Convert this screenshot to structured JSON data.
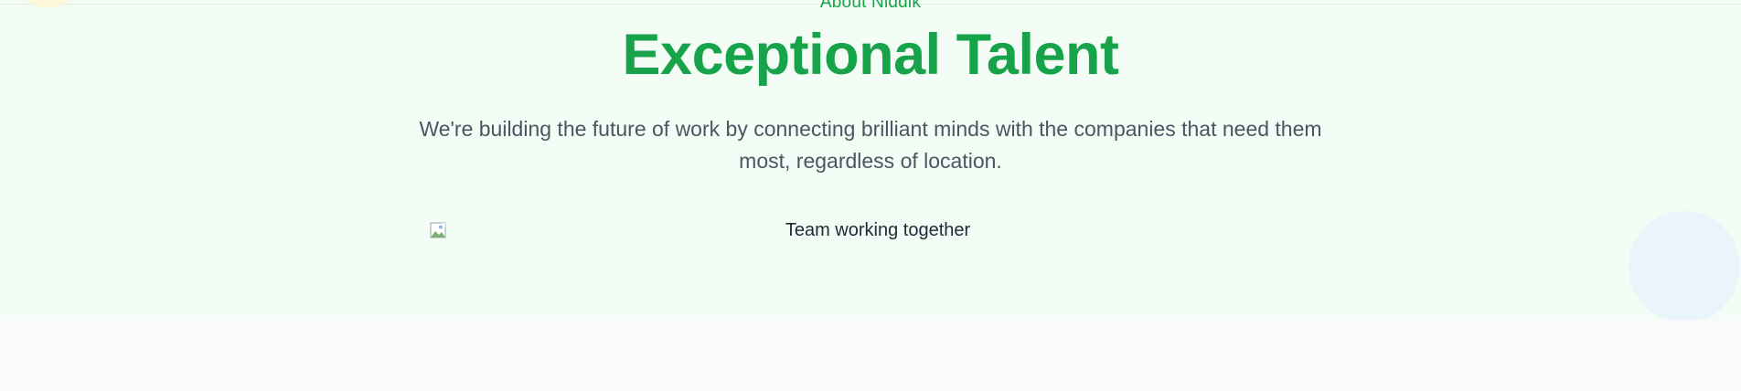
{
  "about": {
    "eyebrow": "About Niddik",
    "headline": "Exceptional Talent",
    "subtitle": "We're building the future of work by connecting brilliant minds with the companies that need them most, regardless of location."
  },
  "image": {
    "alt": "Team working together",
    "icon": "broken-image-icon"
  },
  "colors": {
    "accent": "#17a34a",
    "hero_background": "#f3fcf5",
    "page_background": "#f8fafc",
    "body_text": "#4b5563"
  }
}
